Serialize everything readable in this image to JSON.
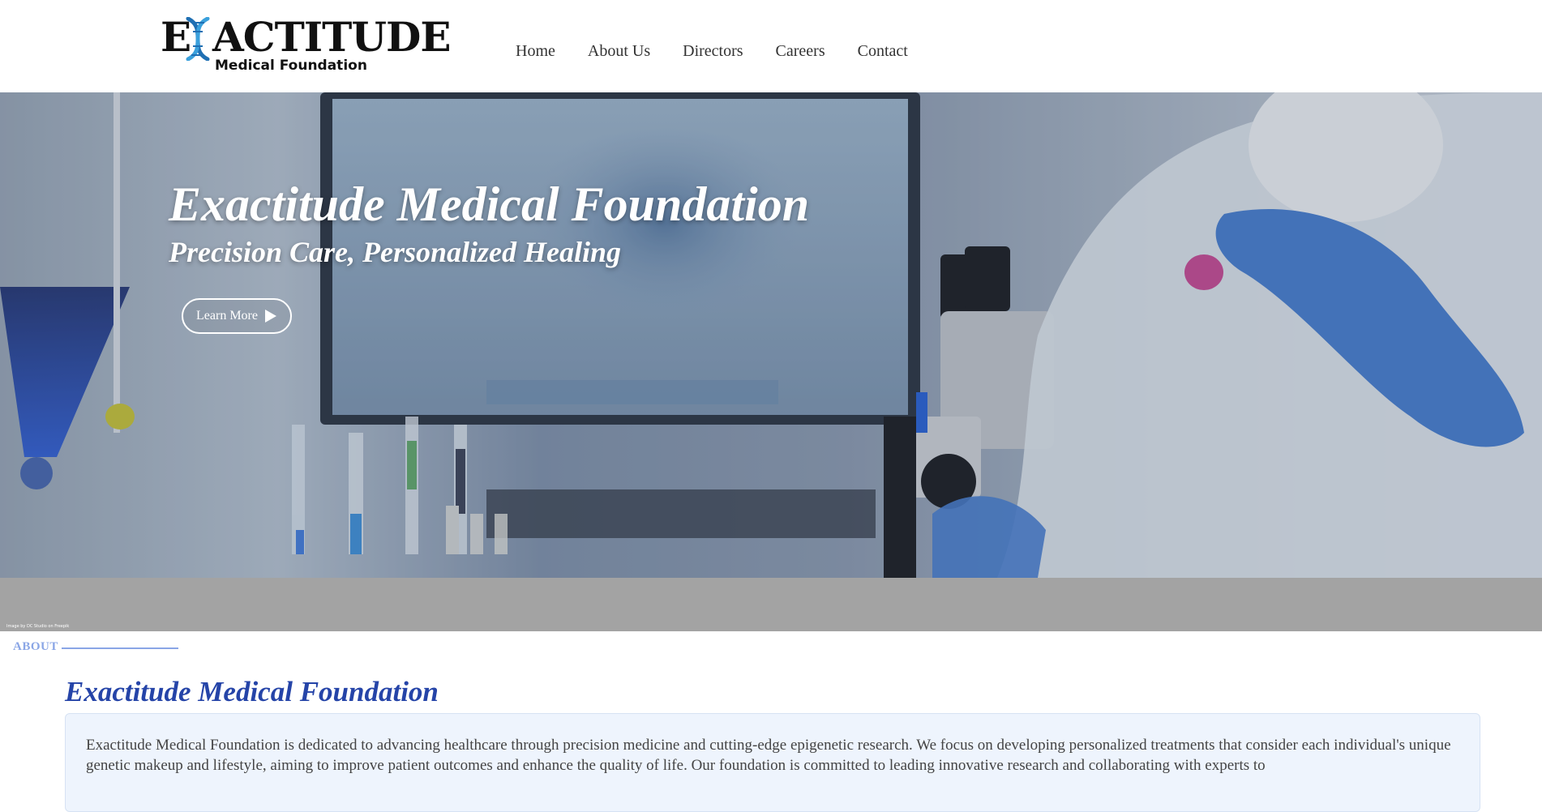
{
  "header": {
    "logo": {
      "word_first": "E",
      "word_rest": "ACTITUDE",
      "subtitle": "Medical Foundation"
    },
    "nav": [
      {
        "label": "Home"
      },
      {
        "label": "About Us"
      },
      {
        "label": "Directors"
      },
      {
        "label": "Careers"
      },
      {
        "label": "Contact"
      }
    ]
  },
  "hero": {
    "title": "Exactitude Medical Foundation",
    "subtitle": "Precision Care, Personalized Healing",
    "button_label": "Learn More",
    "button_icon": "play-icon",
    "image_credit": "Image by DC Studio on Freepik"
  },
  "about": {
    "section_label": "ABOUT",
    "title": "Exactitude Medical Foundation",
    "text": "Exactitude Medical Foundation is dedicated to advancing healthcare through precision medicine and cutting-edge epigenetic research. We focus on developing personalized treatments that consider each individual's unique genetic makeup and lifestyle, aiming to improve patient outcomes and enhance the quality of life. Our foundation is committed to leading innovative research and collaborating with experts to"
  },
  "colors": {
    "accent_blue": "#2544a8",
    "label_blue": "#8aa6e6",
    "card_bg": "#eef4fd",
    "band_gray": "#a3a3a3"
  }
}
